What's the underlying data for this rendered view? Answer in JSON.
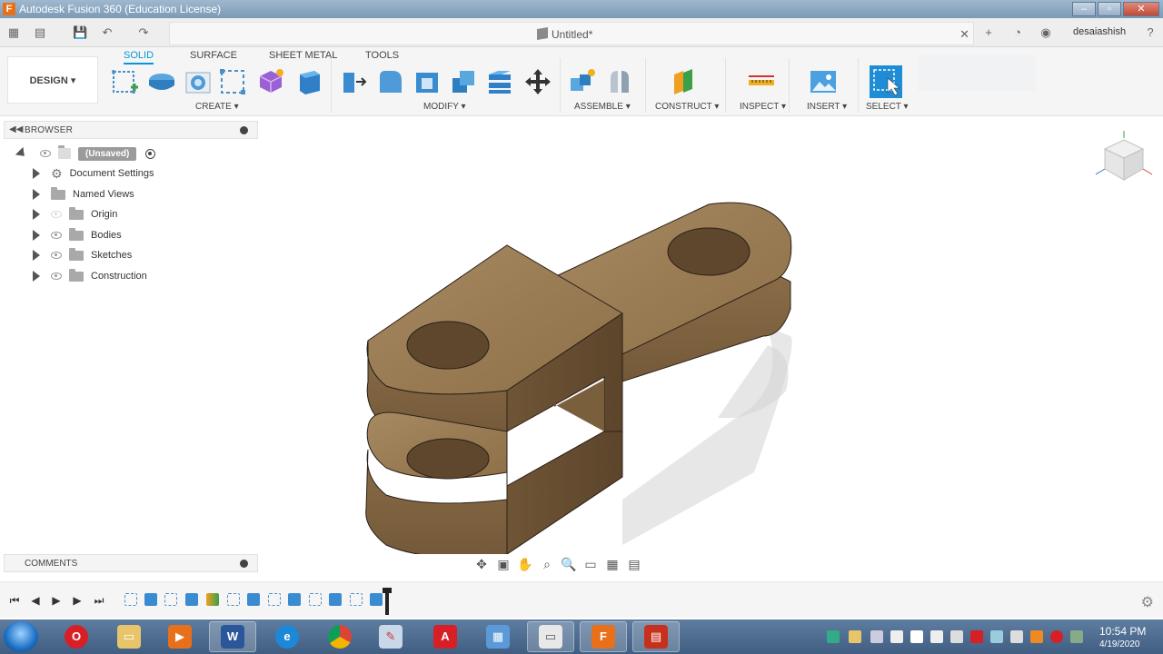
{
  "window": {
    "title": "Autodesk Fusion 360 (Education License)"
  },
  "appbar": {
    "doc_title": "Untitled*",
    "user": "desaiashish"
  },
  "ribbon": {
    "workspace": "DESIGN",
    "tabs": [
      {
        "label": "SOLID",
        "active": true
      },
      {
        "label": "SURFACE"
      },
      {
        "label": "SHEET METAL"
      },
      {
        "label": "TOOLS"
      }
    ],
    "groups": [
      {
        "label": "CREATE"
      },
      {
        "label": "MODIFY"
      },
      {
        "label": "ASSEMBLE"
      },
      {
        "label": "CONSTRUCT"
      },
      {
        "label": "INSPECT"
      },
      {
        "label": "INSERT"
      },
      {
        "label": "SELECT"
      }
    ]
  },
  "browser": {
    "header": "BROWSER",
    "root": "(Unsaved)",
    "items": [
      {
        "label": "Document Settings"
      },
      {
        "label": "Named Views"
      },
      {
        "label": "Origin"
      },
      {
        "label": "Bodies"
      },
      {
        "label": "Sketches"
      },
      {
        "label": "Construction"
      }
    ]
  },
  "comments": {
    "header": "COMMENTS"
  },
  "taskbar": {
    "time": "10:54 PM",
    "date": "4/19/2020"
  },
  "colors": {
    "accent": "#0696d7",
    "wood": "#9c7d55",
    "wood_dark": "#6e5434",
    "ribbon_bg": "#f5f5f5"
  }
}
